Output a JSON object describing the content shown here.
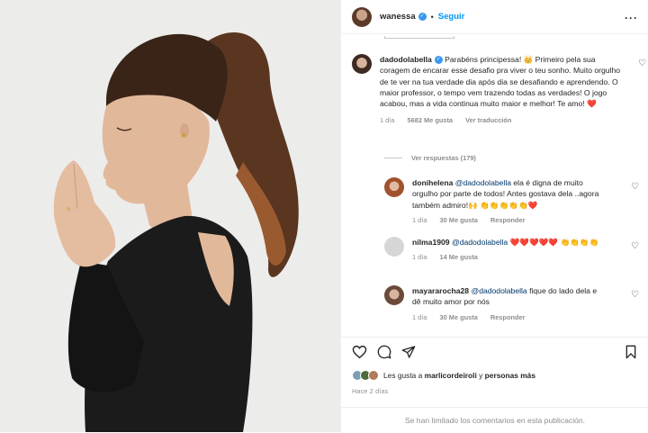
{
  "header": {
    "username": "wanessa",
    "verified_icon": "verified-badge-icon",
    "separator": "•",
    "follow_label": "Seguir",
    "more_icon": "more-options-icon"
  },
  "comments": [
    {
      "username": "dadodolabella",
      "text": "Parabéns principessa! 👑 Primeiro pela sua coragem de encarar esse desafio pra viver o teu sonho. Muito orgulho de te ver na tua verdade dia após dia se desafiando e aprendendo. O maior professor, o tempo vem trazendo todas as verdades! O jogo acabou, mas a vida continua muito maior e melhor! Te amo! ❤️",
      "time": "1 día",
      "likes": "5682 Me gusta",
      "translate": "Ver traducción"
    }
  ],
  "view_replies": "Ver respuestas (179)",
  "replies": [
    {
      "username": "donihelena",
      "mention": "@dadodolabella",
      "text": "ela é digna de muito orgulho por parte de todos! Antes gostava dela ..agora também admiro!🙌 👏👏👏👏👏❤️",
      "time": "1 día",
      "likes": "30 Me gusta",
      "reply": "Responder"
    },
    {
      "username": "nilma1909",
      "mention": "@dadodolabella",
      "text": "❤️❤️❤️❤️❤️ 👏👏👏👏",
      "time": "1 día",
      "likes": "14 Me gusta",
      "reply": "Responder"
    },
    {
      "username": "mayararocha28",
      "mention": "@dadodolabella",
      "text": "fique do lado dela e dê muito amor por nós",
      "time": "1 día",
      "likes": "30 Me gusta",
      "reply": "Responder"
    }
  ],
  "likes_line": {
    "prefix": "Les gusta a",
    "user": "marlicordeiroli",
    "conj": "y",
    "others": "personas más"
  },
  "posted_ago": "Hace 2 días",
  "comments_limited": "Se han limitado los comentarios en esta publicación.",
  "colors": {
    "accent": "#0095f6",
    "verified": "#3897f0",
    "muted": "#8e8e8e",
    "photo_bg": "#ececeb"
  }
}
